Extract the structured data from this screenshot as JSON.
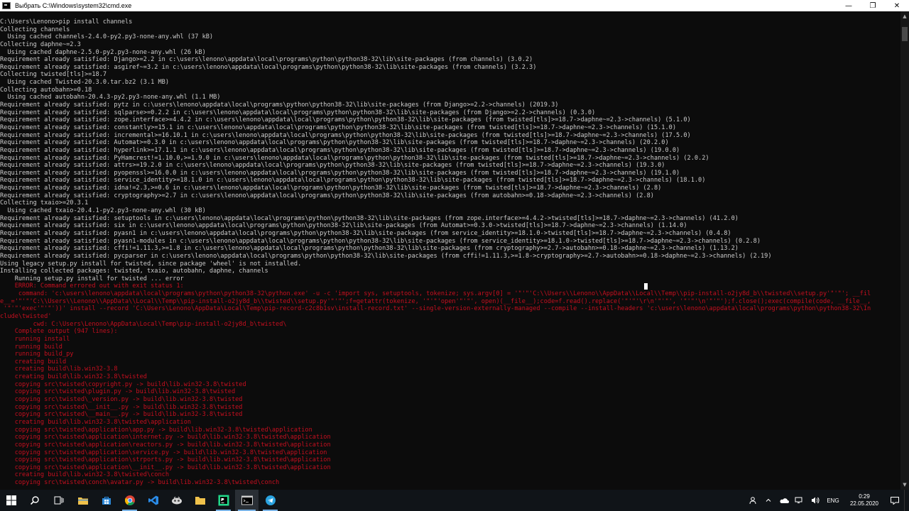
{
  "window": {
    "title": "Выбрать C:\\Windows\\system32\\cmd.exe",
    "minimize_glyph": "—",
    "maximize_glyph": "❐",
    "close_glyph": "✕"
  },
  "console": {
    "lines": [
      {
        "text": "C:\\Users\\Lenono>pip install channels",
        "type": "normal"
      },
      {
        "text": "Collecting channels",
        "type": "normal"
      },
      {
        "text": "  Using cached channels-2.4.0-py2.py3-none-any.whl (37 kB)",
        "type": "normal"
      },
      {
        "text": "Collecting daphne~=2.3",
        "type": "normal"
      },
      {
        "text": "  Using cached daphne-2.5.0-py2.py3-none-any.whl (26 kB)",
        "type": "normal"
      },
      {
        "text": "Requirement already satisfied: Django>=2.2 in c:\\users\\lenono\\appdata\\local\\programs\\python\\python38-32\\lib\\site-packages (from channels) (3.0.2)",
        "type": "normal"
      },
      {
        "text": "Requirement already satisfied: asgiref~=3.2 in c:\\users\\lenono\\appdata\\local\\programs\\python\\python38-32\\lib\\site-packages (from channels) (3.2.3)",
        "type": "normal"
      },
      {
        "text": "Collecting twisted[tls]>=18.7",
        "type": "normal"
      },
      {
        "text": "  Using cached Twisted-20.3.0.tar.bz2 (3.1 MB)",
        "type": "normal"
      },
      {
        "text": "Collecting autobahn>=0.18",
        "type": "normal"
      },
      {
        "text": "  Using cached autobahn-20.4.3-py2.py3-none-any.whl (1.1 MB)",
        "type": "normal"
      },
      {
        "text": "Requirement already satisfied: pytz in c:\\users\\lenono\\appdata\\local\\programs\\python\\python38-32\\lib\\site-packages (from Django>=2.2->channels) (2019.3)",
        "type": "normal"
      },
      {
        "text": "Requirement already satisfied: sqlparse>=0.2.2 in c:\\users\\lenono\\appdata\\local\\programs\\python\\python38-32\\lib\\site-packages (from Django>=2.2->channels) (0.3.0)",
        "type": "normal"
      },
      {
        "text": "Requirement already satisfied: zope.interface>=4.4.2 in c:\\users\\lenono\\appdata\\local\\programs\\python\\python38-32\\lib\\site-packages (from twisted[tls]>=18.7->daphne~=2.3->channels) (5.1.0)",
        "type": "normal"
      },
      {
        "text": "Requirement already satisfied: constantly>=15.1 in c:\\users\\lenono\\appdata\\local\\programs\\python\\python38-32\\lib\\site-packages (from twisted[tls]>=18.7->daphne~=2.3->channels) (15.1.0)",
        "type": "normal"
      },
      {
        "text": "Requirement already satisfied: incremental>=16.10.1 in c:\\users\\lenono\\appdata\\local\\programs\\python\\python38-32\\lib\\site-packages (from twisted[tls]>=18.7->daphne~=2.3->channels) (17.5.0)",
        "type": "normal"
      },
      {
        "text": "Requirement already satisfied: Automat>=0.3.0 in c:\\users\\lenono\\appdata\\local\\programs\\python\\python38-32\\lib\\site-packages (from twisted[tls]>=18.7->daphne~=2.3->channels) (20.2.0)",
        "type": "normal"
      },
      {
        "text": "Requirement already satisfied: hyperlink>=17.1.1 in c:\\users\\lenono\\appdata\\local\\programs\\python\\python38-32\\lib\\site-packages (from twisted[tls]>=18.7->daphne~=2.3->channels) (19.0.0)",
        "type": "normal"
      },
      {
        "text": "Requirement already satisfied: PyHamcrest!=1.10.0,>=1.9.0 in c:\\users\\lenono\\appdata\\local\\programs\\python\\python38-32\\lib\\site-packages (from twisted[tls]>=18.7->daphne~=2.3->channels) (2.0.2)",
        "type": "normal"
      },
      {
        "text": "Requirement already satisfied: attrs>=19.2.0 in c:\\users\\lenono\\appdata\\local\\programs\\python\\python38-32\\lib\\site-packages (from twisted[tls]>=18.7->daphne~=2.3->channels) (19.3.0)",
        "type": "normal"
      },
      {
        "text": "Requirement already satisfied: pyopenssl>=16.0.0 in c:\\users\\lenono\\appdata\\local\\programs\\python\\python38-32\\lib\\site-packages (from twisted[tls]>=18.7->daphne~=2.3->channels) (19.1.0)",
        "type": "normal"
      },
      {
        "text": "Requirement already satisfied: service_identity>=18.1.0 in c:\\users\\lenono\\appdata\\local\\programs\\python\\python38-32\\lib\\site-packages (from twisted[tls]>=18.7->daphne~=2.3->channels) (18.1.0)",
        "type": "normal"
      },
      {
        "text": "Requirement already satisfied: idna!=2.3,>=0.6 in c:\\users\\lenono\\appdata\\local\\programs\\python\\python38-32\\lib\\site-packages (from twisted[tls]>=18.7->daphne~=2.3->channels) (2.8)",
        "type": "normal"
      },
      {
        "text": "Requirement already satisfied: cryptography>=2.7 in c:\\users\\lenono\\appdata\\local\\programs\\python\\python38-32\\lib\\site-packages (from autobahn>=0.18->daphne~=2.3->channels) (2.8)",
        "type": "normal"
      },
      {
        "text": "Collecting txaio>=20.3.1",
        "type": "normal"
      },
      {
        "text": "  Using cached txaio-20.4.1-py2.py3-none-any.whl (30 kB)",
        "type": "normal"
      },
      {
        "text": "Requirement already satisfied: setuptools in c:\\users\\lenono\\appdata\\local\\programs\\python\\python38-32\\lib\\site-packages (from zope.interface>=4.4.2->twisted[tls]>=18.7->daphne~=2.3->channels) (41.2.0)",
        "type": "normal"
      },
      {
        "text": "Requirement already satisfied: six in c:\\users\\lenono\\appdata\\local\\programs\\python\\python38-32\\lib\\site-packages (from Automat>=0.3.0->twisted[tls]>=18.7->daphne~=2.3->channels) (1.14.0)",
        "type": "normal"
      },
      {
        "text": "Requirement already satisfied: pyasn1 in c:\\users\\lenono\\appdata\\local\\programs\\python\\python38-32\\lib\\site-packages (from service_identity>=18.1.0->twisted[tls]>=18.7->daphne~=2.3->channels) (0.4.8)",
        "type": "normal"
      },
      {
        "text": "Requirement already satisfied: pyasn1-modules in c:\\users\\lenono\\appdata\\local\\programs\\python\\python38-32\\lib\\site-packages (from service_identity>=18.1.0->twisted[tls]>=18.7->daphne~=2.3->channels) (0.2.8)",
        "type": "normal"
      },
      {
        "text": "Requirement already satisfied: cffi!=1.11.3,>=1.8 in c:\\users\\lenono\\appdata\\local\\programs\\python\\python38-32\\lib\\site-packages (from cryptography>=2.7->autobahn>=0.18->daphne~=2.3->channels) (1.13.2)",
        "type": "normal"
      },
      {
        "text": "Requirement already satisfied: pycparser in c:\\users\\lenono\\appdata\\local\\programs\\python\\python38-32\\lib\\site-packages (from cffi!=1.11.3,>=1.8->cryptography>=2.7->autobahn>=0.18->daphne~=2.3->channels) (2.19)",
        "type": "normal"
      },
      {
        "text": "Using legacy setup.py install for twisted, since package 'wheel' is not installed.",
        "type": "normal"
      },
      {
        "text": "Installing collected packages: twisted, txaio, autobahn, daphne, channels",
        "type": "normal"
      },
      {
        "text": "    Running setup.py install for twisted ... error",
        "type": "normal"
      },
      {
        "text": "    ERROR: Command errored out with exit status 1:",
        "type": "err"
      },
      {
        "text": "     command: 'c:\\users\\lenono\\appdata\\local\\programs\\python\\python38-32\\python.exe' -u -c 'import sys, setuptools, tokenize; sys.argv[0] = '\"'\"'C:\\\\Users\\\\Lenono\\\\AppData\\\\Local\\\\Temp\\\\pip-install-o2jy8d_b\\\\twisted\\\\setup.py'\"'\"'; __fil",
        "type": "err"
      },
      {
        "text": "e__='\"'\"'C:\\\\Users\\\\Lenono\\\\AppData\\\\Local\\\\Temp\\\\pip-install-o2jy8d_b\\\\twisted\\\\setup.py'\"'\"';f=getattr(tokenize, '\"'\"'open'\"'\"', open)(__file__);code=f.read().replace('\"'\"'\\r\\n'\"'\"', '\"'\"'\\n'\"'\"');f.close();exec(compile(code, __file__,",
        "type": "err"
      },
      {
        "text": " '\"'\"'exec'\"'\"'))' install --record 'C:\\Users\\Lenono\\AppData\\Local\\Temp\\pip-record-c2c8b1sv\\install-record.txt' --single-version-externally-managed --compile --install-headers 'c:\\users\\lenono\\appdata\\local\\programs\\python\\python38-32\\In",
        "type": "err"
      },
      {
        "text": "clude\\twisted'",
        "type": "err"
      },
      {
        "text": "         cwd: C:\\Users\\Lenono\\AppData\\Local\\Temp\\pip-install-o2jy8d_b\\twisted\\",
        "type": "err"
      },
      {
        "text": "    Complete output (947 lines):",
        "type": "err"
      },
      {
        "text": "    running install",
        "type": "err"
      },
      {
        "text": "    running build",
        "type": "err"
      },
      {
        "text": "    running build_py",
        "type": "err"
      },
      {
        "text": "    creating build",
        "type": "err"
      },
      {
        "text": "    creating build\\lib.win32-3.8",
        "type": "err"
      },
      {
        "text": "    creating build\\lib.win32-3.8\\twisted",
        "type": "err"
      },
      {
        "text": "    copying src\\twisted\\copyright.py -> build\\lib.win32-3.8\\twisted",
        "type": "err"
      },
      {
        "text": "    copying src\\twisted\\plugin.py -> build\\lib.win32-3.8\\twisted",
        "type": "err"
      },
      {
        "text": "    copying src\\twisted\\_version.py -> build\\lib.win32-3.8\\twisted",
        "type": "err"
      },
      {
        "text": "    copying src\\twisted\\__init__.py -> build\\lib.win32-3.8\\twisted",
        "type": "err"
      },
      {
        "text": "    copying src\\twisted\\__main__.py -> build\\lib.win32-3.8\\twisted",
        "type": "err"
      },
      {
        "text": "    creating build\\lib.win32-3.8\\twisted\\application",
        "type": "err"
      },
      {
        "text": "    copying src\\twisted\\application\\app.py -> build\\lib.win32-3.8\\twisted\\application",
        "type": "err"
      },
      {
        "text": "    copying src\\twisted\\application\\internet.py -> build\\lib.win32-3.8\\twisted\\application",
        "type": "err"
      },
      {
        "text": "    copying src\\twisted\\application\\reactors.py -> build\\lib.win32-3.8\\twisted\\application",
        "type": "err"
      },
      {
        "text": "    copying src\\twisted\\application\\service.py -> build\\lib.win32-3.8\\twisted\\application",
        "type": "err"
      },
      {
        "text": "    copying src\\twisted\\application\\strports.py -> build\\lib.win32-3.8\\twisted\\application",
        "type": "err"
      },
      {
        "text": "    copying src\\twisted\\application\\__init__.py -> build\\lib.win32-3.8\\twisted\\application",
        "type": "err"
      },
      {
        "text": "    creating build\\lib.win32-3.8\\twisted\\conch",
        "type": "err"
      },
      {
        "text": "    copying src\\twisted\\conch\\avatar.py -> build\\lib.win32-3.8\\twisted\\conch",
        "type": "err"
      }
    ]
  },
  "taskbar": {
    "icons": [
      {
        "name": "windows-start-icon",
        "state": "",
        "color": "#ffffff"
      },
      {
        "name": "search-icon",
        "state": "",
        "color": "#ffffff"
      },
      {
        "name": "task-view-icon",
        "state": "",
        "color": "#ffffff"
      },
      {
        "name": "file-explorer-icon",
        "state": "",
        "color": "#f0c24b"
      },
      {
        "name": "store-icon",
        "state": "",
        "color": "#2b88d8"
      },
      {
        "name": "chrome-icon",
        "state": "running",
        "color": "#db4437"
      },
      {
        "name": "vscode-icon",
        "state": "",
        "color": "#2b8ce8"
      },
      {
        "name": "app-icon",
        "state": "",
        "color": "#d8d8d8"
      },
      {
        "name": "folder-icon",
        "state": "",
        "color": "#f0c24b"
      },
      {
        "name": "pycharm-icon",
        "state": "running",
        "color": "#21d789"
      },
      {
        "name": "cmd-icon",
        "state": "active",
        "color": "#cccccc"
      },
      {
        "name": "telegram-icon",
        "state": "running",
        "color": "#2aa3e0"
      }
    ],
    "tray": {
      "language": "ENG",
      "time": "0:29",
      "date": "22.05.2020"
    }
  }
}
